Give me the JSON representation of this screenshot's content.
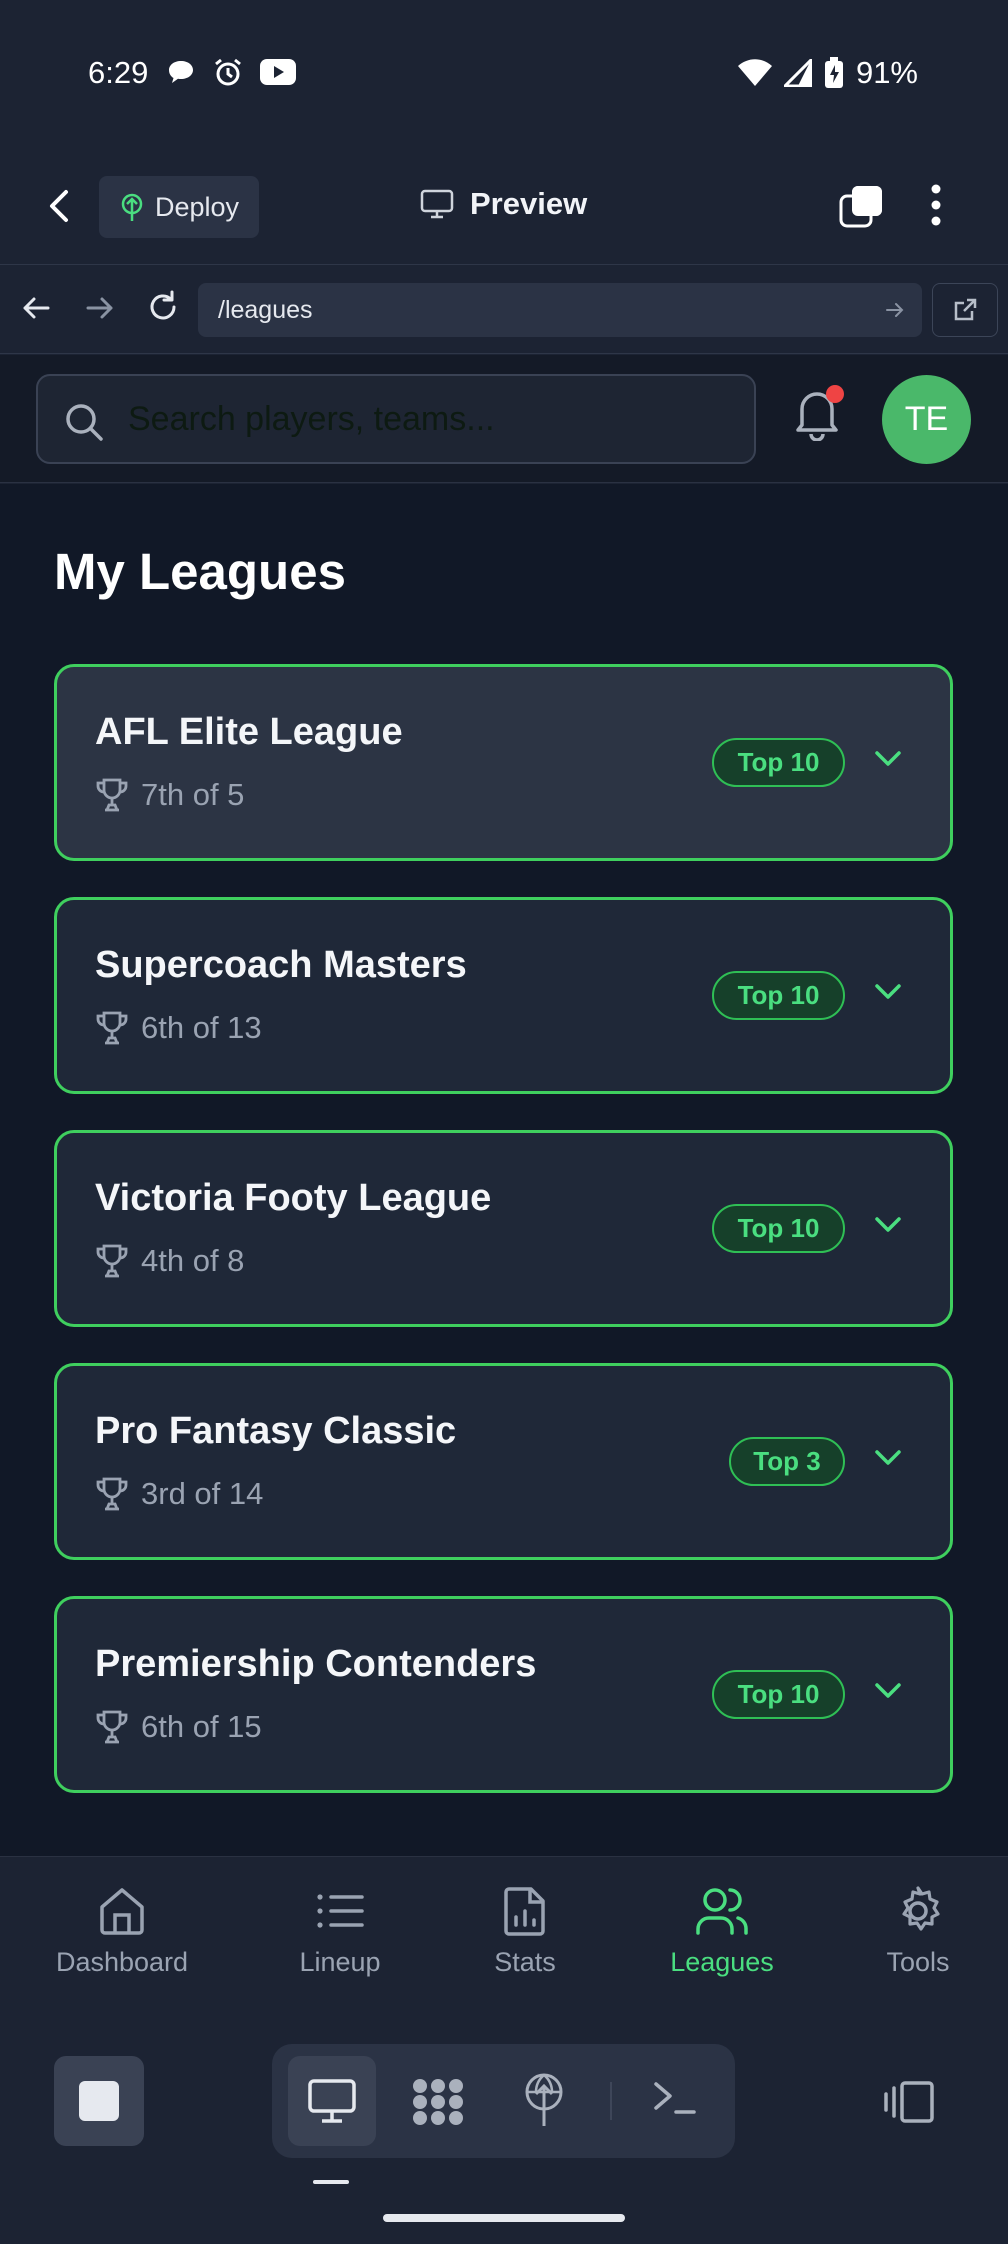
{
  "status_bar": {
    "time": "6:29",
    "battery": "91%"
  },
  "toolbar": {
    "deploy_label": "Deploy",
    "preview_label": "Preview"
  },
  "browser": {
    "url": "/leagues"
  },
  "header": {
    "search_placeholder": "Search players, teams...",
    "avatar_initials": "TE"
  },
  "page": {
    "title": "My Leagues"
  },
  "leagues": [
    {
      "name": "AFL Elite League",
      "rank": "7th of 5",
      "badge": "Top 10"
    },
    {
      "name": "Supercoach Masters",
      "rank": "6th of 13",
      "badge": "Top 10"
    },
    {
      "name": "Victoria Footy League",
      "rank": "4th of 8",
      "badge": "Top 10"
    },
    {
      "name": "Pro Fantasy Classic",
      "rank": "3rd of 14",
      "badge": "Top 3"
    },
    {
      "name": "Premiership Contenders",
      "rank": "6th of 15",
      "badge": "Top 10"
    }
  ],
  "nav": {
    "items": [
      {
        "label": "Dashboard",
        "icon": "home-icon"
      },
      {
        "label": "Lineup",
        "icon": "list-icon"
      },
      {
        "label": "Stats",
        "icon": "report-icon"
      },
      {
        "label": "Leagues",
        "icon": "users-icon",
        "active": true
      },
      {
        "label": "Tools",
        "icon": "gear-icon"
      }
    ]
  },
  "colors": {
    "accent": "#4ade80",
    "card_border": "#3fcf5e",
    "avatar": "#4ab86a",
    "notification": "#ef4444"
  }
}
